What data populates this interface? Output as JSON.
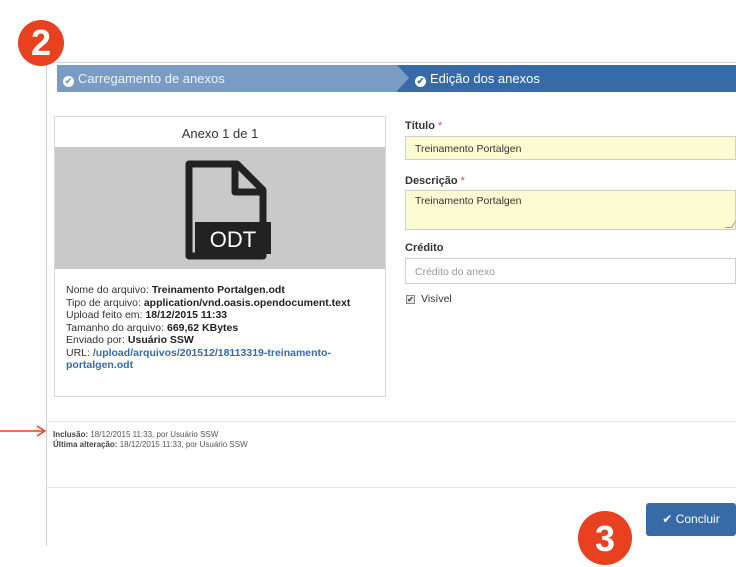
{
  "badges": {
    "step_two": "2",
    "step_three": "3"
  },
  "colors": {
    "accent": "#376ba7",
    "step_done": "#7a9cc4",
    "badge": "#e8411f",
    "annotation_arrow": "#e8411f",
    "field_highlight": "#fdfbd1"
  },
  "wizard": {
    "steps": [
      {
        "label": "Carregamento de anexos",
        "icon": "check-circle-icon",
        "state": "done"
      },
      {
        "label": "Edição dos anexos",
        "icon": "check-circle-icon",
        "state": "active"
      }
    ]
  },
  "attachment": {
    "counter": "Anexo 1 de 1",
    "file_type_badge": "ODT",
    "meta": {
      "name_label": "Nome do arquivo:",
      "name_value": "Treinamento Portalgen.odt",
      "type_label": "Tipo de arquivo:",
      "type_value": "application/vnd.oasis.opendocument.text",
      "upload_label": "Upload feito em:",
      "upload_value": "18/12/2015 11:33",
      "size_label": "Tamanho do arquivo:",
      "size_value": "669,62 KBytes",
      "sent_label": "Enviado por:",
      "sent_value": "Usuário SSW",
      "url_label": "URL:",
      "url_value_line1": "/upload/arquivos/201512/18113319-treinamento-",
      "url_value_line2": "portalgen.odt"
    }
  },
  "form": {
    "title_label": "Título",
    "title_value": "Treinamento Portalgen",
    "description_label": "Descrição",
    "description_value": "Treinamento Portalgen",
    "credit_label": "Crédito",
    "credit_placeholder": "Crédito do anexo",
    "visible_label": "Visível",
    "visible_checked": true,
    "required_mark": "*"
  },
  "audit": {
    "created_label": "Inclusão:",
    "created_value": "18/12/2015 11:33, por Usuário SSW",
    "modified_label": "Última alteração:",
    "modified_value": "18/12/2015 11:33, por Usuário SSW"
  },
  "actions": {
    "conclude_label": "Concluir",
    "conclude_icon": "check-icon"
  }
}
